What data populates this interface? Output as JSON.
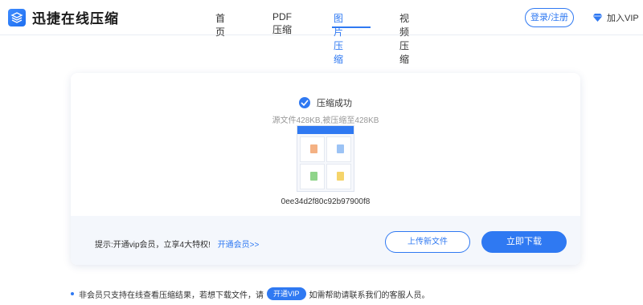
{
  "header": {
    "logo_text": "迅捷在线压缩",
    "nav": [
      {
        "label": "首页",
        "active": false
      },
      {
        "label": "PDF压缩",
        "active": false
      },
      {
        "label": "图片压缩",
        "active": true
      },
      {
        "label": "视频压缩",
        "active": false
      }
    ],
    "login_label": "登录/注册",
    "vip_label": "加入VIP"
  },
  "result": {
    "status_text": "压缩成功",
    "detail_text": "源文件428KB,被压缩至428KB",
    "filename": "0ee34d2f80c92b97900f8"
  },
  "footer_bar": {
    "tip_text": "提示:开通vip会员，立享4大特权!",
    "tip_link": "开通会员>>",
    "upload_label": "上传新文件",
    "download_label": "立即下载"
  },
  "note": {
    "text_before": "非会员只支持在线查看压缩结果，若想下载文件，请",
    "vip_button": "开通VIP",
    "text_after": "如需帮助请联系我们的客服人员。"
  },
  "colors": {
    "accent": "#2f79f2",
    "card_footer_bg": "#f4f7fc"
  }
}
